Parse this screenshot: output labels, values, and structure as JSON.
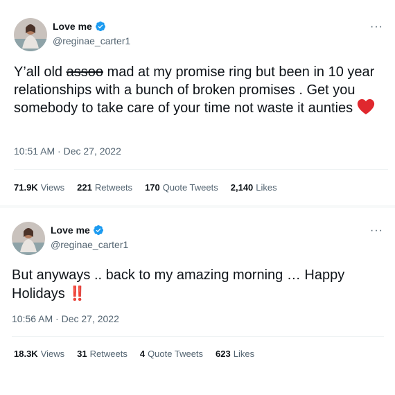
{
  "tweets": [
    {
      "display_name": "Love me",
      "handle": "@reginae_carter1",
      "more": "···",
      "text_before": "Y’all old ",
      "text_struck": "assoo",
      "text_after": " mad at my promise ring but been in 10 year relationships with a bunch of broken promises . Get you somebody to take care of your time not waste it aunties ",
      "emoji": "red-heart",
      "timestamp": "10:51 AM · Dec 27, 2022",
      "stats": [
        {
          "value": "71.9K",
          "label": "Views"
        },
        {
          "value": "221",
          "label": "Retweets"
        },
        {
          "value": "170",
          "label": "Quote Tweets"
        },
        {
          "value": "2,140",
          "label": "Likes"
        }
      ]
    },
    {
      "display_name": "Love me",
      "handle": "@reginae_carter1",
      "more": "···",
      "text": "But anyways .. back to my amazing morning … Happy Holidays ",
      "emoji_text": "‼️",
      "timestamp": "10:56 AM · Dec 27, 2022",
      "stats": [
        {
          "value": "18.3K",
          "label": "Views"
        },
        {
          "value": "31",
          "label": "Retweets"
        },
        {
          "value": "4",
          "label": "Quote Tweets"
        },
        {
          "value": "623",
          "label": "Likes"
        }
      ]
    }
  ],
  "colors": {
    "verified": "#1d9bf0",
    "heart": "#e0282e",
    "muted": "#536471"
  }
}
